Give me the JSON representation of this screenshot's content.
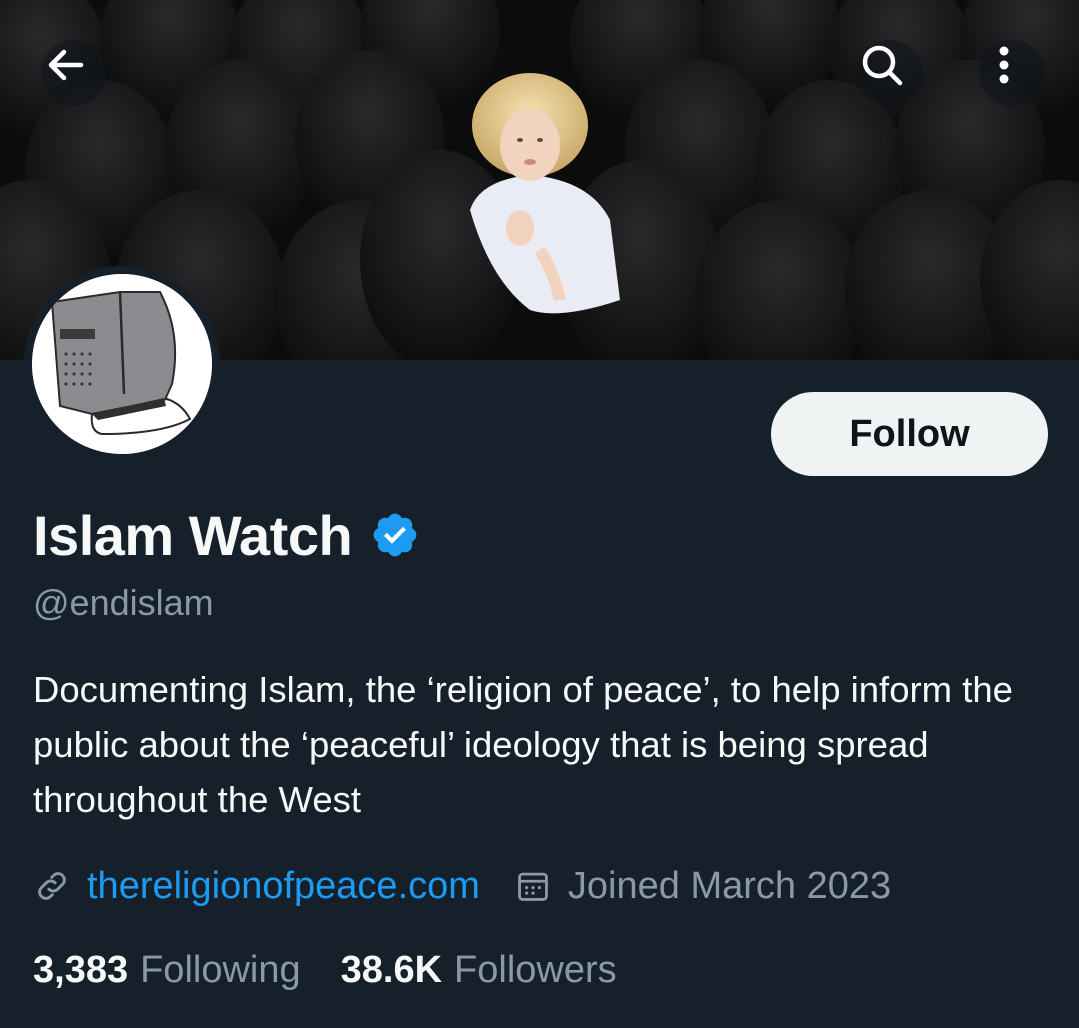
{
  "header": {
    "back_icon": "arrow-left-icon",
    "search_icon": "search-icon",
    "more_icon": "more-vertical-icon"
  },
  "profile": {
    "display_name": "Islam Watch",
    "verified_icon": "verified-badge-icon",
    "handle": "@endislam",
    "bio": "Documenting Islam, the ‘religion of peace’, to help inform the public about the ‘peaceful’ ideology that is being spread throughout the West",
    "website": "thereligionofpeace.com",
    "joined": "Joined March 2023",
    "follow_label": "Follow"
  },
  "stats": {
    "following_count": "3,383",
    "following_label": "Following",
    "followers_count": "38.6K",
    "followers_label": "Followers"
  },
  "colors": {
    "background": "#15202b",
    "accent": "#1d9bf0",
    "muted": "#8b98a5",
    "text": "#f7f9f9"
  }
}
